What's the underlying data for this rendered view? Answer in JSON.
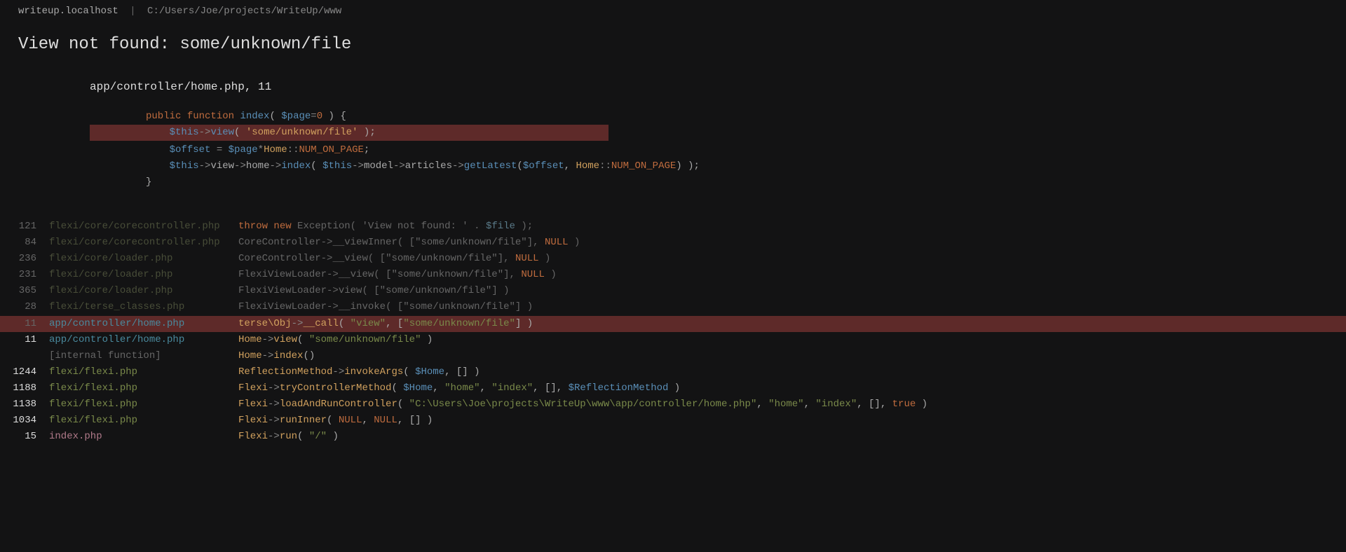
{
  "header": {
    "host": "writeup.localhost",
    "sep": "|",
    "path": "C:/Users/Joe/projects/WriteUp/www"
  },
  "error_title": "View not found: some/unknown/file",
  "source": {
    "file_label": "app/controller/home.php, 11",
    "lines": {
      "l0": {
        "kw1": "public",
        "kw2": "function",
        "name": "index",
        "p1": "(",
        "var": "$page",
        "eq": "=",
        "num": "0",
        "p2": ")",
        "brace": " {"
      },
      "l1": {
        "var": "$this",
        "arrow": "->",
        "method": "view",
        "p1": "(",
        "str": "'some/unknown/file'",
        "p2": ")",
        "semi": ";"
      },
      "l2": "",
      "l3": {
        "var1": "$offset",
        "eq": " = ",
        "var2": "$page",
        "star": "*",
        "cls": "Home",
        "cc": "::",
        "const": "NUM_ON_PAGE",
        "semi": ";"
      },
      "l4": {
        "var1": "$this",
        "a1": "->",
        "p1": "view",
        "a2": "->",
        "p2": "home",
        "a3": "->",
        "m": "index",
        "op": "(",
        "var2": "$this",
        "a4": "->",
        "p3": "model",
        "a5": "->",
        "p4": "articles",
        "a6": "->",
        "m2": "getLatest",
        "op2": "(",
        "var3": "$offset",
        "comma": ", ",
        "cls": "Home",
        "cc": "::",
        "const": "NUM_ON_PAGE",
        "cp2": ")",
        "cp": ")",
        "semi": ";"
      },
      "l5": "}"
    }
  },
  "trace": [
    {
      "line": "121",
      "file": "flexi/core/corecontroller.php",
      "style": "dim",
      "tokens": [
        [
          "kw",
          "throw"
        ],
        [
          "plain",
          " "
        ],
        [
          "kw",
          "new"
        ],
        [
          "plain",
          " "
        ],
        [
          "class",
          "Exception"
        ],
        [
          "punc",
          "( "
        ],
        [
          "str",
          "'View not found: '"
        ],
        [
          "plain",
          " . "
        ],
        [
          "var",
          "$file"
        ],
        [
          "punc",
          " );"
        ]
      ]
    },
    {
      "line": "84",
      "file": "flexi/core/corecontroller.php",
      "style": "dim",
      "tokens": [
        [
          "class",
          "CoreController"
        ],
        [
          "arrow",
          "->"
        ],
        [
          "method",
          "__viewInner"
        ],
        [
          "punc",
          "( ["
        ],
        [
          "str",
          "\"some/unknown/file\""
        ],
        [
          "punc",
          "], "
        ],
        [
          "null",
          "NULL"
        ],
        [
          "punc",
          " )"
        ]
      ]
    },
    {
      "line": "236",
      "file": "flexi/core/loader.php",
      "style": "dim",
      "tokens": [
        [
          "class",
          "CoreController"
        ],
        [
          "arrow",
          "->"
        ],
        [
          "method",
          "__view"
        ],
        [
          "punc",
          "( ["
        ],
        [
          "str",
          "\"some/unknown/file\""
        ],
        [
          "punc",
          "], "
        ],
        [
          "null",
          "NULL"
        ],
        [
          "punc",
          " )"
        ]
      ]
    },
    {
      "line": "231",
      "file": "flexi/core/loader.php",
      "style": "dim",
      "tokens": [
        [
          "class",
          "FlexiViewLoader"
        ],
        [
          "arrow",
          "->"
        ],
        [
          "method",
          "__view"
        ],
        [
          "punc",
          "( ["
        ],
        [
          "str",
          "\"some/unknown/file\""
        ],
        [
          "punc",
          "], "
        ],
        [
          "null",
          "NULL"
        ],
        [
          "punc",
          " )"
        ]
      ]
    },
    {
      "line": "365",
      "file": "flexi/core/loader.php",
      "style": "dim",
      "tokens": [
        [
          "class",
          "FlexiViewLoader"
        ],
        [
          "arrow",
          "->"
        ],
        [
          "method",
          "view"
        ],
        [
          "punc",
          "( ["
        ],
        [
          "str",
          "\"some/unknown/file\""
        ],
        [
          "punc",
          "] )"
        ]
      ]
    },
    {
      "line": "28",
      "file": "flexi/terse_classes.php",
      "style": "dim",
      "tokens": [
        [
          "class",
          "FlexiViewLoader"
        ],
        [
          "arrow",
          "->"
        ],
        [
          "method",
          "__invoke"
        ],
        [
          "punc",
          "( ["
        ],
        [
          "str",
          "\"some/unknown/file\""
        ],
        [
          "punc",
          "] )"
        ]
      ]
    },
    {
      "line": "11",
      "file": "app/controller/home.php",
      "style": "sel",
      "file_style": "active",
      "tokens": [
        [
          "class",
          "terse\\Obj"
        ],
        [
          "arrow",
          "->"
        ],
        [
          "method",
          "__call"
        ],
        [
          "punc",
          "( "
        ],
        [
          "str",
          "\"view\""
        ],
        [
          "punc",
          ", ["
        ],
        [
          "str",
          "\"some/unknown/file\""
        ],
        [
          "punc",
          "] )"
        ]
      ]
    },
    {
      "line": "11",
      "file": "app/controller/home.php",
      "style": "bright",
      "file_style": "app",
      "tokens": [
        [
          "class",
          "Home"
        ],
        [
          "arrow",
          "->"
        ],
        [
          "method",
          "view"
        ],
        [
          "punc",
          "( "
        ],
        [
          "str",
          "\"some/unknown/file\""
        ],
        [
          "punc",
          " )"
        ]
      ]
    },
    {
      "line": "",
      "file": "[internal function]",
      "style": "bright",
      "file_style": "internal",
      "tokens": [
        [
          "class",
          "Home"
        ],
        [
          "arrow",
          "->"
        ],
        [
          "method",
          "index"
        ],
        [
          "punc",
          "()"
        ]
      ]
    },
    {
      "line": "1244",
      "file": "flexi/flexi.php",
      "style": "bright",
      "file_style": "green",
      "tokens": [
        [
          "class",
          "ReflectionMethod"
        ],
        [
          "arrow",
          "->"
        ],
        [
          "method",
          "invokeArgs"
        ],
        [
          "punc",
          "( "
        ],
        [
          "var",
          "$Home"
        ],
        [
          "punc",
          ", [] )"
        ]
      ]
    },
    {
      "line": "1188",
      "file": "flexi/flexi.php",
      "style": "bright",
      "file_style": "green",
      "tokens": [
        [
          "class",
          "Flexi"
        ],
        [
          "arrow",
          "->"
        ],
        [
          "method",
          "tryControllerMethod"
        ],
        [
          "punc",
          "( "
        ],
        [
          "var",
          "$Home"
        ],
        [
          "punc",
          ", "
        ],
        [
          "str",
          "\"home\""
        ],
        [
          "punc",
          ", "
        ],
        [
          "str",
          "\"index\""
        ],
        [
          "punc",
          ", [], "
        ],
        [
          "var",
          "$ReflectionMethod"
        ],
        [
          "punc",
          " )"
        ]
      ]
    },
    {
      "line": "1138",
      "file": "flexi/flexi.php",
      "style": "bright",
      "file_style": "green",
      "tokens": [
        [
          "class",
          "Flexi"
        ],
        [
          "arrow",
          "->"
        ],
        [
          "method",
          "loadAndRunController"
        ],
        [
          "punc",
          "( "
        ],
        [
          "str",
          "\"C:\\Users\\Joe\\projects\\WriteUp\\www\\app/controller/home.php\""
        ],
        [
          "punc",
          ", "
        ],
        [
          "str",
          "\"home\""
        ],
        [
          "punc",
          ", "
        ],
        [
          "str",
          "\"index\""
        ],
        [
          "punc",
          ", [], "
        ],
        [
          "true",
          "true"
        ],
        [
          "punc",
          " )"
        ]
      ]
    },
    {
      "line": "1034",
      "file": "flexi/flexi.php",
      "style": "bright",
      "file_style": "green",
      "tokens": [
        [
          "class",
          "Flexi"
        ],
        [
          "arrow",
          "->"
        ],
        [
          "method",
          "runInner"
        ],
        [
          "punc",
          "( "
        ],
        [
          "null",
          "NULL"
        ],
        [
          "punc",
          ", "
        ],
        [
          "null",
          "NULL"
        ],
        [
          "punc",
          ", [] )"
        ]
      ]
    },
    {
      "line": "15",
      "file": "index.php",
      "style": "bright",
      "file_style": "pink",
      "tokens": [
        [
          "class",
          "Flexi"
        ],
        [
          "arrow",
          "->"
        ],
        [
          "method",
          "run"
        ],
        [
          "punc",
          "( "
        ],
        [
          "str",
          "\"/\""
        ],
        [
          "punc",
          " )"
        ]
      ]
    }
  ]
}
